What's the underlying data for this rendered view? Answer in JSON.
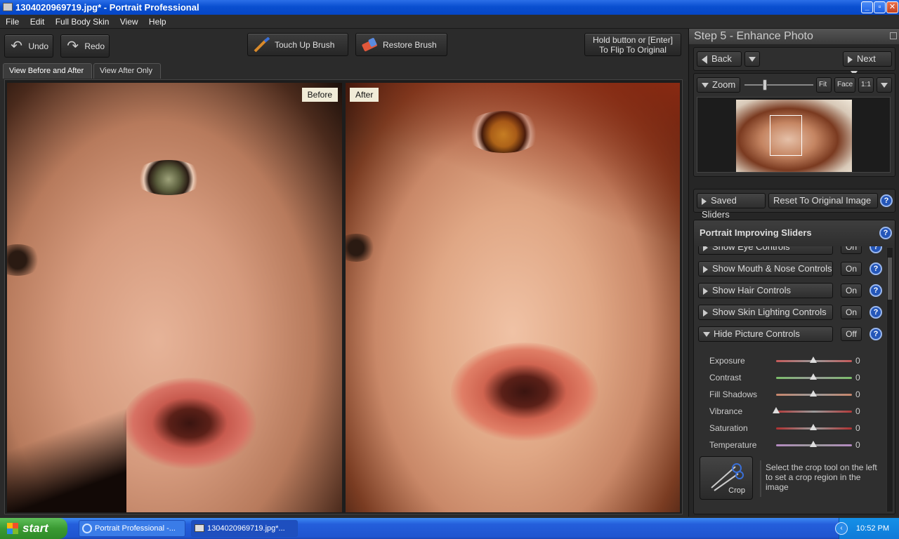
{
  "window": {
    "title": "1304020969719.jpg* - Portrait Professional"
  },
  "menu": [
    "File",
    "Edit",
    "Full Body Skin",
    "View",
    "Help"
  ],
  "toolbar": {
    "undo": "Undo",
    "redo": "Redo",
    "touch_up": "Touch Up Brush",
    "restore": "Restore Brush",
    "flip_line1": "Hold button or [Enter]",
    "flip_line2": "To Flip To Original"
  },
  "view_tabs": [
    "View Before and After",
    "View After Only"
  ],
  "photos": {
    "before_label": "Before",
    "after_label": "After"
  },
  "panel": {
    "step_title": "Step 5 - Enhance Photo",
    "back": "Back",
    "next": "Next",
    "zoom": "Zoom",
    "zoom_buttons": [
      "Fit",
      "Face",
      "1:1"
    ],
    "zoom_level": 0.3,
    "saved_sliders": "Saved Sliders",
    "reset": "Reset To Original Image",
    "sliders_title": "Portrait Improving Sliders",
    "controls": [
      {
        "label": "Show Eye Controls",
        "state": "On"
      },
      {
        "label": "Show Mouth & Nose Controls",
        "state": "On"
      },
      {
        "label": "Show Hair Controls",
        "state": "On"
      },
      {
        "label": "Show Skin Lighting Controls",
        "state": "On"
      },
      {
        "label": "Hide Picture Controls",
        "state": "Off"
      }
    ],
    "sliders": [
      {
        "label": "Exposure",
        "value": "0",
        "level": 0.5,
        "color": "#c65a5a"
      },
      {
        "label": "Contrast",
        "value": "0",
        "level": 0.5,
        "color": "#7bbf6a"
      },
      {
        "label": "Fill Shadows",
        "value": "0",
        "level": 0.5,
        "color": "#c9866b"
      },
      {
        "label": "Vibrance",
        "value": "0",
        "level": 0.0,
        "color": "#b33a3a"
      },
      {
        "label": "Saturation",
        "value": "0",
        "level": 0.5,
        "color": "#b03030"
      },
      {
        "label": "Temperature",
        "value": "0",
        "level": 0.5,
        "color": "#b58ac2"
      }
    ],
    "crop_label": "Crop",
    "crop_hint": "Select the crop tool on the left to set a crop region in the image"
  },
  "taskbar": {
    "start": "start",
    "items": [
      "Portrait Professional -...",
      "1304020969719.jpg*..."
    ],
    "clock": "10:52 PM"
  }
}
